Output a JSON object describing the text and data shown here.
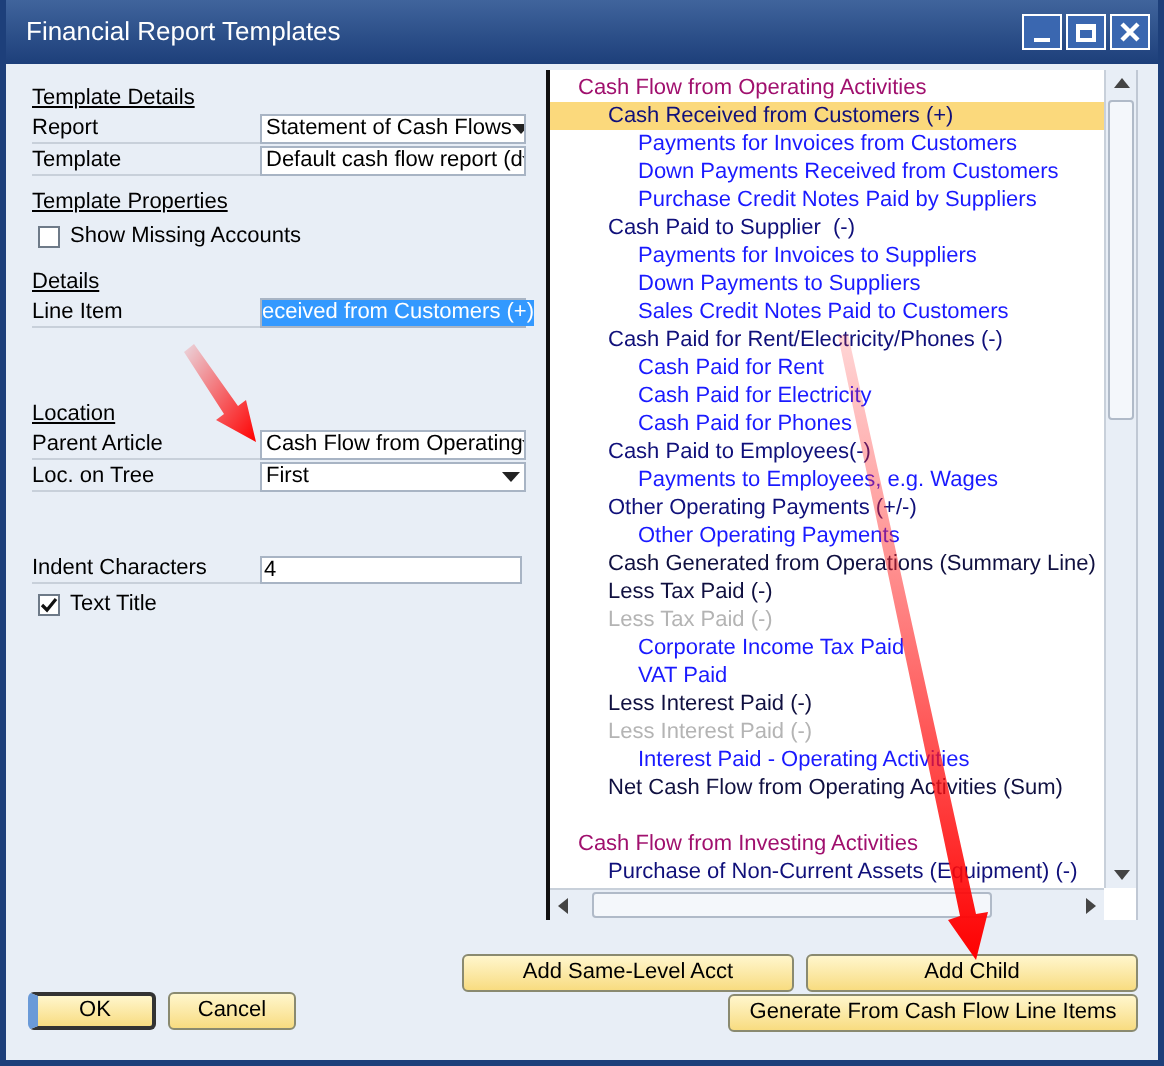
{
  "window": {
    "title": "Financial Report Templates"
  },
  "sections": [
    {
      "kind": "heading",
      "label": "Template Details"
    },
    {
      "kind": "select",
      "label": "Report",
      "value": "Statement of Cash Flows"
    },
    {
      "kind": "select",
      "label": "Template",
      "value": "Default cash flow report (d"
    },
    {
      "kind": "heading",
      "label": "Template Properties"
    },
    {
      "kind": "checkbox",
      "label": "Show Missing Accounts",
      "checked": false
    },
    {
      "kind": "heading",
      "label": "Details"
    },
    {
      "kind": "selected_text",
      "label": "Line Item",
      "value": "eceived from Customers (+)"
    },
    {
      "kind": "spacer"
    },
    {
      "kind": "heading",
      "label": "Location"
    },
    {
      "kind": "select",
      "label": "Parent Article",
      "value": "Cash Flow from Operating"
    },
    {
      "kind": "select",
      "label": "Loc. on Tree",
      "value": "First"
    },
    {
      "kind": "spacer"
    },
    {
      "kind": "text",
      "label": "Indent Characters",
      "value": "4"
    },
    {
      "kind": "checkbox",
      "label": "Text Title",
      "checked": true
    }
  ],
  "tree": [
    {
      "label": "Cash Flow from Operating Activities",
      "kind": "section",
      "selected": false,
      "children": [
        {
          "label": "Cash Received from Customers (+)",
          "kind": "group",
          "selected": true,
          "children": [
            {
              "label": "Payments for Invoices from Customers",
              "kind": "account",
              "selected": false
            },
            {
              "label": "Down Payments Received from Customers",
              "kind": "account",
              "selected": false
            },
            {
              "label": "Purchase Credit Notes Paid by Suppliers",
              "kind": "account",
              "selected": false
            }
          ]
        },
        {
          "label": "Cash Paid to Supplier  (-)",
          "kind": "group",
          "selected": false,
          "children": [
            {
              "label": "Payments for Invoices to Suppliers",
              "kind": "account",
              "selected": false
            },
            {
              "label": "Down Payments to Suppliers",
              "kind": "account",
              "selected": false
            },
            {
              "label": "Sales Credit Notes Paid to Customers",
              "kind": "account",
              "selected": false
            }
          ]
        },
        {
          "label": "Cash Paid for Rent/Electricity/Phones (-)",
          "kind": "group",
          "selected": false,
          "children": [
            {
              "label": "Cash Paid for Rent",
              "kind": "account",
              "selected": false
            },
            {
              "label": "Cash Paid for Electricity",
              "kind": "account",
              "selected": false
            },
            {
              "label": "Cash Paid for Phones",
              "kind": "account",
              "selected": false
            }
          ]
        },
        {
          "label": "Cash Paid to Employees(-)",
          "kind": "group",
          "selected": false,
          "children": [
            {
              "label": "Payments to Employees, e.g. Wages",
              "kind": "account",
              "selected": false
            }
          ]
        },
        {
          "label": "Other Operating Payments (+/-)",
          "kind": "group",
          "selected": false,
          "children": [
            {
              "label": "Other Operating Payments",
              "kind": "account",
              "selected": false
            }
          ]
        },
        {
          "label": "Cash Generated from Operations (Summary Line)",
          "kind": "total",
          "selected": false
        },
        {
          "label": "Less Tax Paid (-)",
          "kind": "total",
          "selected": false
        },
        {
          "label": "Less Tax Paid (-)",
          "kind": "inactive",
          "selected": false,
          "children": [
            {
              "label": "Corporate Income Tax Paid",
              "kind": "account",
              "selected": false
            },
            {
              "label": "VAT Paid",
              "kind": "account",
              "selected": false
            }
          ]
        },
        {
          "label": "Less Interest Paid (-)",
          "kind": "total",
          "selected": false
        },
        {
          "label": "Less Interest Paid (-)",
          "kind": "inactive",
          "selected": false,
          "children": [
            {
              "label": "Interest Paid - Operating Activities",
              "kind": "account",
              "selected": false
            }
          ]
        },
        {
          "label": "Net Cash Flow from Operating Activities (Sum)",
          "kind": "total",
          "selected": false
        }
      ]
    },
    {
      "label": "Cash Flow from Investing Activities",
      "kind": "section",
      "selected": false,
      "children": [
        {
          "label": "Purchase of Non-Current Assets (Equipment) (-)",
          "kind": "group",
          "selected": false
        }
      ]
    }
  ],
  "buttons": {
    "left": [
      "OK",
      "Cancel"
    ],
    "right_top": [
      "Add Same-Level Acct",
      "Add Child"
    ],
    "right_bottom": [
      "Generate From Cash Flow Line Items"
    ]
  }
}
